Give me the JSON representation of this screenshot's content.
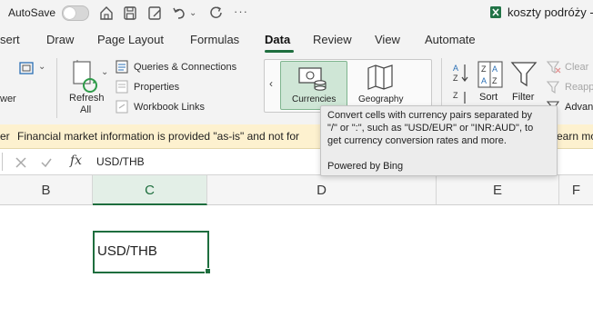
{
  "titlebar": {
    "autosave_label": "AutoSave",
    "more_label": "···",
    "doc_title": "koszty podróży -"
  },
  "tabs": [
    {
      "label": "sert"
    },
    {
      "label": "Draw"
    },
    {
      "label": "Page Layout"
    },
    {
      "label": "Formulas"
    },
    {
      "label": "Data"
    },
    {
      "label": "Review"
    },
    {
      "label": "View"
    },
    {
      "label": "Automate"
    }
  ],
  "ribbon": {
    "partial_left_label": "wer",
    "refresh_label_1": "Refresh",
    "refresh_label_2": "All",
    "queries_label": "Queries & Connections",
    "properties_label": "Properties",
    "workbook_links_label": "Workbook Links",
    "currencies_label": "Currencies",
    "geography_label": "Geography",
    "sort_label": "Sort",
    "filter_label": "Filter",
    "clear_label": "Clear",
    "reapply_label": "Reapp",
    "advanced_label": "Advan"
  },
  "tooltip": {
    "line1": "Convert cells with currency pairs separated by",
    "line2": "\"/\" or \":\", such as \"USD/EUR\" or \"INR:AUD\", to",
    "line3": "get currency conversion rates and more.",
    "powered": "Powered by Bing"
  },
  "infobar": {
    "prefix": "er",
    "message": "Financial market information is provided \"as-is\" and not for",
    "suffix": "earn mo"
  },
  "formula_bar": {
    "fx_label": "fx",
    "value": "USD/THB"
  },
  "columns": [
    "B",
    "C",
    "D",
    "E",
    "F"
  ],
  "selected_cell": {
    "column": "C",
    "value": "USD/THB"
  },
  "colors": {
    "accent_green": "#217346",
    "active_tab_underline": "#1e6e3e",
    "infobar_bg": "#fdf1cf"
  }
}
